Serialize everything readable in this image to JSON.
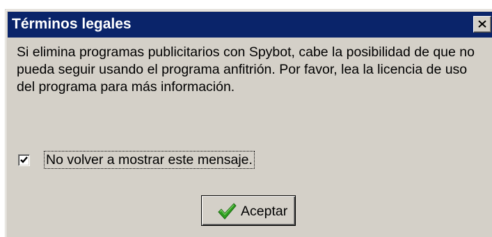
{
  "window": {
    "title": "Términos legales",
    "close_icon": "close-icon"
  },
  "message": {
    "text": "Si elimina programas publicitarios con Spybot, cabe la posibilidad de que no pueda seguir usando el programa anfitrión. Por favor, lea la licencia de uso del programa para más información."
  },
  "checkbox": {
    "label": "No volver a mostrar este mensaje.",
    "checked": true
  },
  "buttons": {
    "accept_label": "Aceptar",
    "accept_icon": "checkmark-icon"
  },
  "colors": {
    "titlebar": "#0a246a",
    "face": "#d4d0c8",
    "check_green": "#2e9e1f"
  }
}
